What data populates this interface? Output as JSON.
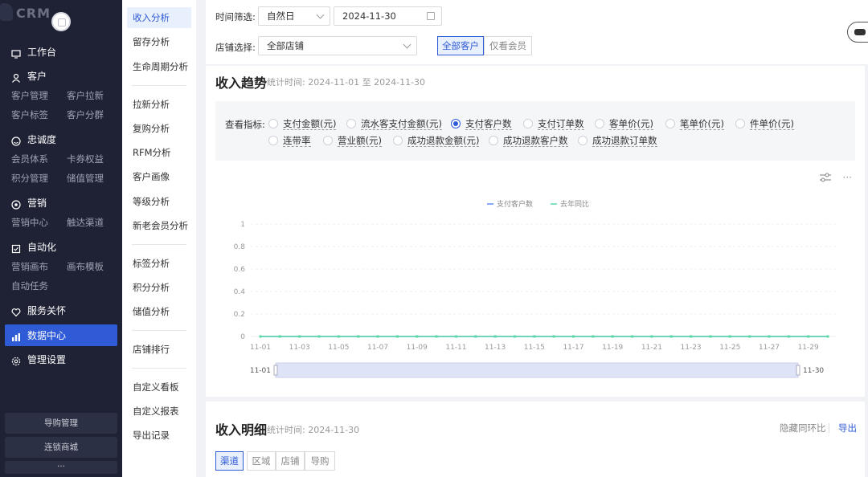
{
  "logo": {
    "text": "CRM"
  },
  "sidebar": {
    "groups": [
      {
        "label": "工作台",
        "icon": "workbench-icon",
        "subs": []
      },
      {
        "label": "客户",
        "icon": "customer-icon",
        "subs": [
          "客户管理",
          "客户拉新",
          "客户标签",
          "客户分群"
        ]
      },
      {
        "label": "忠诚度",
        "icon": "loyalty-icon",
        "subs": [
          "会员体系",
          "卡券权益",
          "积分管理",
          "储值管理"
        ]
      },
      {
        "label": "营销",
        "icon": "marketing-icon",
        "subs": [
          "营销中心",
          "触达渠道"
        ]
      },
      {
        "label": "自动化",
        "icon": "automation-icon",
        "subs": [
          "营销画布",
          "画布模板",
          "自动任务"
        ]
      },
      {
        "label": "服务关怀",
        "icon": "heart-icon",
        "subs": []
      },
      {
        "label": "数据中心",
        "icon": "bar-chart-icon",
        "subs": []
      },
      {
        "label": "管理设置",
        "icon": "gear-icon",
        "subs": []
      }
    ],
    "bottom": [
      "导购管理",
      "连锁商城",
      "···"
    ]
  },
  "submenu": {
    "items": [
      "收入分析",
      "留存分析",
      "生命周期分析",
      "拉新分析",
      "复购分析",
      "RFM分析",
      "客户画像",
      "等级分析",
      "新老会员分析",
      "标签分析",
      "积分分析",
      "储值分析",
      "店铺排行",
      "自定义看板",
      "自定义报表",
      "导出记录"
    ]
  },
  "filter": {
    "time_label": "时间筛选:",
    "time_type": "自然日",
    "date": "2024-11-30",
    "store_label": "店铺选择:",
    "store": "全部店铺",
    "seg_all": "全部客户",
    "seg_member": "仅看会员"
  },
  "trend": {
    "title": "收入趋势",
    "sub": "统计时间: 2024-11-01 至 2024-11-30",
    "metric_label": "查看指标:",
    "metrics": [
      "支付金额(元)",
      "流水客支付金额(元)",
      "支付客户数",
      "支付订单数",
      "客单价(元)",
      "笔单价(元)",
      "件单价(元)",
      "连带率",
      "营业额(元)",
      "成功退款金额(元)",
      "成功退款客户数",
      "成功退款订单数"
    ],
    "selected_metric": "支付客户数"
  },
  "chart_data": {
    "type": "line",
    "x": [
      "11-01",
      "11-02",
      "11-03",
      "11-04",
      "11-05",
      "11-06",
      "11-07",
      "11-08",
      "11-09",
      "11-10",
      "11-11",
      "11-12",
      "11-13",
      "11-14",
      "11-15",
      "11-16",
      "11-17",
      "11-18",
      "11-19",
      "11-20",
      "11-21",
      "11-22",
      "11-23",
      "11-24",
      "11-25",
      "11-26",
      "11-27",
      "11-28",
      "11-29",
      "11-30"
    ],
    "x_tick_labels": [
      "11-01",
      "11-03",
      "11-05",
      "11-07",
      "11-09",
      "11-11",
      "11-13",
      "11-15",
      "11-17",
      "11-19",
      "11-21",
      "11-23",
      "11-25",
      "11-27",
      "11-29"
    ],
    "y_ticks": [
      "0",
      "0.2",
      "0.4",
      "0.6",
      "0.8",
      "1"
    ],
    "ylim": [
      0,
      1
    ],
    "series": [
      {
        "name": "支付客户数",
        "color": "#5b8ff9",
        "values": [
          0,
          0,
          0,
          0,
          0,
          0,
          0,
          0,
          0,
          0,
          0,
          0,
          0,
          0,
          0,
          0,
          0,
          0,
          0,
          0,
          0,
          0,
          0,
          0,
          0,
          0,
          0,
          0,
          0,
          0
        ]
      },
      {
        "name": "去年同比",
        "color": "#5ad8a6",
        "values": [
          0,
          0,
          0,
          0,
          0,
          0,
          0,
          0,
          0,
          0,
          0,
          0,
          0,
          0,
          0,
          0,
          0,
          0,
          0,
          0,
          0,
          0,
          0,
          0,
          0,
          0,
          0,
          0,
          0,
          0
        ]
      }
    ],
    "range_start": "11-01",
    "range_end": "11-30",
    "legend": "top-center"
  },
  "detail": {
    "title": "收入明细",
    "sub": "统计时间: 2024-11-30",
    "hide_label": "隐藏同环比",
    "export_label": "导出",
    "tabs": [
      "渠道",
      "区域",
      "店铺",
      "导购"
    ]
  }
}
